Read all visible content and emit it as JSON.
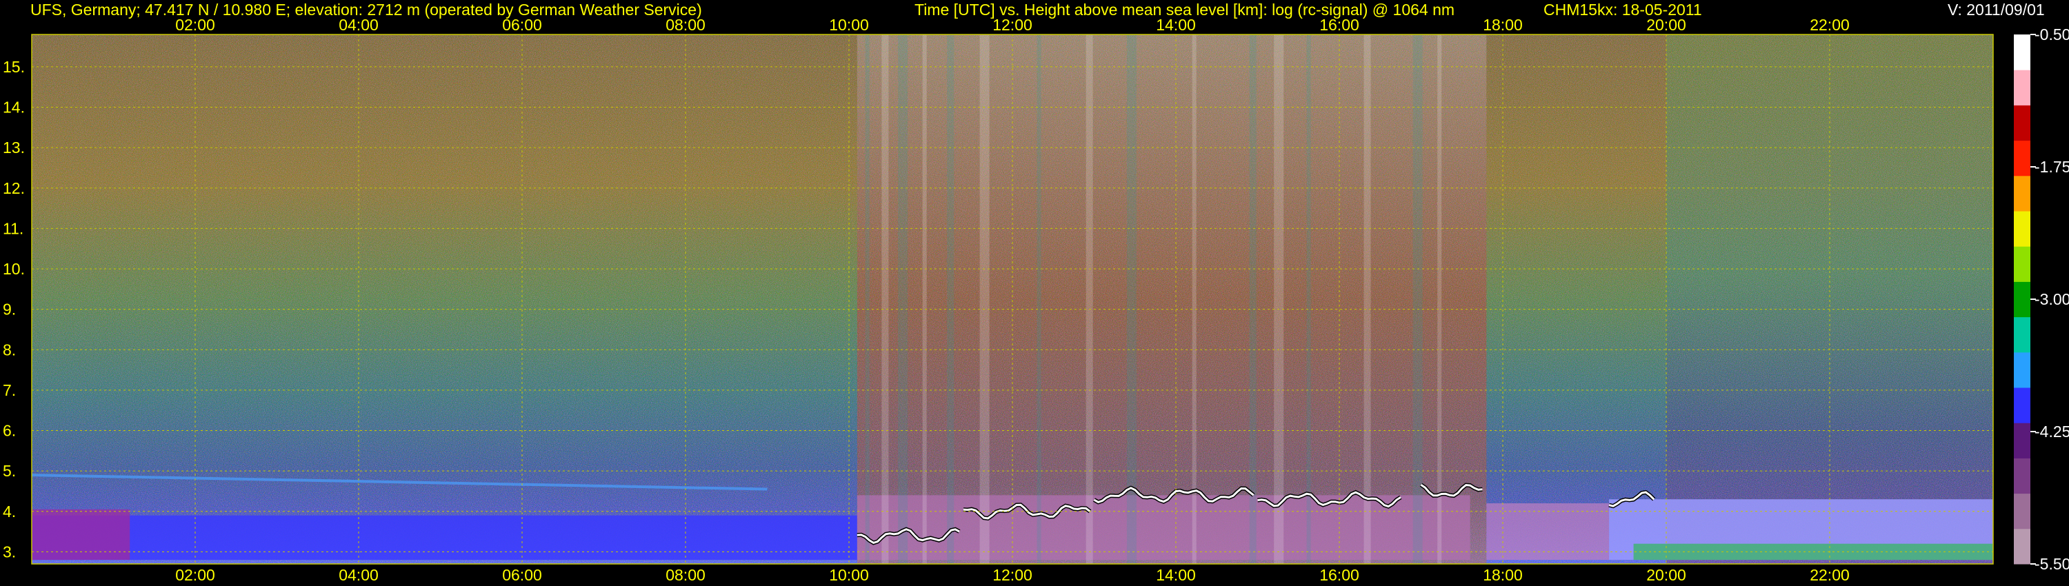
{
  "header": {
    "station": "UFS, Germany; 47.417 N / 10.980 E; elevation: 2712 m  (operated by German Weather Service)",
    "axes_title": "Time [UTC] vs. Height above mean sea level [km]: log (rc-signal) @ 1064 nm",
    "instrument": "CHM15kx: 18-05-2011",
    "version": "V: 2011/09/01"
  },
  "colors": {
    "background": "#000000",
    "text": "#ffff00",
    "grid": "#c8c800",
    "colorbar_text": "#ffffff"
  },
  "chart_data": {
    "type": "heatmap",
    "title": "Time [UTC] vs. Height above mean sea level [km]: log (rc-signal) @ 1064 nm",
    "xlabel": "Time [UTC]",
    "ylabel": "Height above mean sea level [km]",
    "x_ticks": [
      "02:00",
      "04:00",
      "06:00",
      "08:00",
      "10:00",
      "12:00",
      "14:00",
      "16:00",
      "18:00",
      "20:00",
      "22:00"
    ],
    "x_tick_hours": [
      2,
      4,
      6,
      8,
      10,
      12,
      14,
      16,
      18,
      20,
      22
    ],
    "xlim_hours": [
      0,
      24
    ],
    "y_ticks": [
      "3.",
      "4.",
      "5.",
      "6.",
      "7.",
      "8.",
      "9.",
      "10.",
      "11.",
      "12.",
      "13.",
      "14.",
      "15."
    ],
    "y_tick_values": [
      3,
      4,
      5,
      6,
      7,
      8,
      9,
      10,
      11,
      12,
      13,
      14,
      15
    ],
    "ylim_km": [
      2.7,
      15.8
    ],
    "grid": true,
    "colorbar": {
      "ticks": [
        "-0.50",
        "-1.75",
        "-3.00",
        "-4.25",
        "-5.50"
      ],
      "tick_values": [
        -0.5,
        -1.75,
        -3.0,
        -4.25,
        -5.5
      ],
      "range": [
        -5.5,
        -0.5
      ],
      "colormap": [
        "#b89ab0",
        "#9c6e98",
        "#7a3c86",
        "#5a1a7a",
        "#3030ff",
        "#28a0ff",
        "#00c8a0",
        "#00a000",
        "#90e000",
        "#f0f000",
        "#ffa000",
        "#ff2000",
        "#c00000",
        "#ffb0c0",
        "#ffffff"
      ]
    },
    "features": {
      "boundary_layer_top_km": [
        {
          "from_h": 10.1,
          "to_h": 11.4,
          "km": 3.4
        },
        {
          "from_h": 11.4,
          "to_h": 13.0,
          "km": 4.0
        },
        {
          "from_h": 13.0,
          "to_h": 15.0,
          "km": 4.4
        },
        {
          "from_h": 15.0,
          "to_h": 16.8,
          "km": 4.3
        },
        {
          "from_h": 17.0,
          "to_h": 17.8,
          "km": 4.5
        },
        {
          "from_h": 19.3,
          "to_h": 19.9,
          "km": 4.3
        }
      ],
      "aerosol_layer_km": 4.9
    }
  }
}
